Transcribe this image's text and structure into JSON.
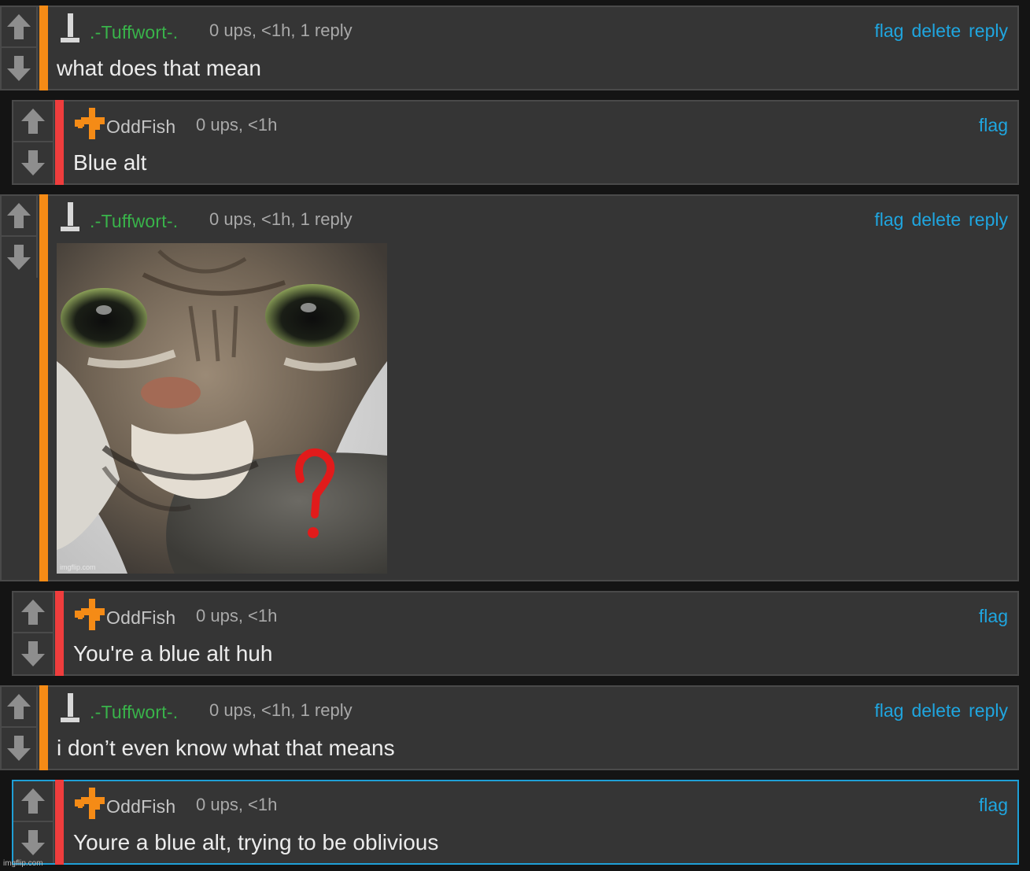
{
  "comments": [
    {
      "username": ".-Tuffwort-.",
      "meta": "0 ups, <1h, 1 reply",
      "actions": [
        "flag",
        "delete",
        "reply"
      ],
      "text": "what does that mean"
    },
    {
      "username": "OddFish",
      "meta": "0 ups, <1h",
      "actions": [
        "flag"
      ],
      "text": "Blue alt"
    },
    {
      "username": ".-Tuffwort-.",
      "meta": "0 ups, <1h, 1 reply",
      "actions": [
        "flag",
        "delete",
        "reply"
      ],
      "image_watermark": "imgflip.com"
    },
    {
      "username": "OddFish",
      "meta": "0 ups, <1h",
      "actions": [
        "flag"
      ],
      "text": "You're a blue alt huh"
    },
    {
      "username": ".-Tuffwort-.",
      "meta": "0 ups, <1h, 1 reply",
      "actions": [
        "flag",
        "delete",
        "reply"
      ],
      "text": "i don’t even know what that means"
    },
    {
      "username": "OddFish",
      "meta": "0 ups, <1h",
      "actions": [
        "flag"
      ],
      "text": "Youre a blue alt, trying to be oblivious"
    }
  ],
  "site_watermark": "imgflip.com",
  "colors": {
    "background": "#141414",
    "panel": "#353535",
    "link": "#1fa6e0",
    "username_tuffwort": "#39b34a",
    "username_oddfish": "#c5c5c5",
    "bar_orange": "#f58b16",
    "bar_red": "#ef3d3d",
    "selected_border": "#1f9fd6"
  },
  "icons": {
    "upvote": "arrow-up-icon",
    "downvote": "arrow-down-icon",
    "tuffwort_avatar": "pillar-avatar-icon",
    "oddfish_avatar": "orange-cross-avatar-icon"
  }
}
